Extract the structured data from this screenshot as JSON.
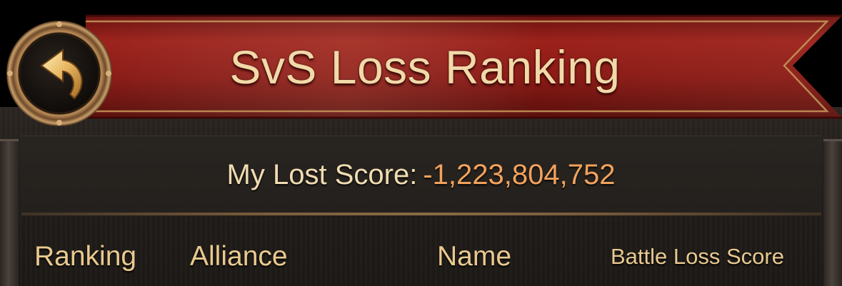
{
  "header": {
    "title": "SvS Loss Ranking",
    "back_icon": "curved-back-arrow-icon"
  },
  "score": {
    "label": "My Lost Score:",
    "value": "-1,223,804,752"
  },
  "table": {
    "columns": [
      "Ranking",
      "Alliance",
      "Name",
      "Battle Loss Score"
    ]
  },
  "colors": {
    "banner_red": "#8e1a15",
    "title_text": "#f1d9a8",
    "score_value": "#f2a25c",
    "header_text": "#e9c98e"
  }
}
